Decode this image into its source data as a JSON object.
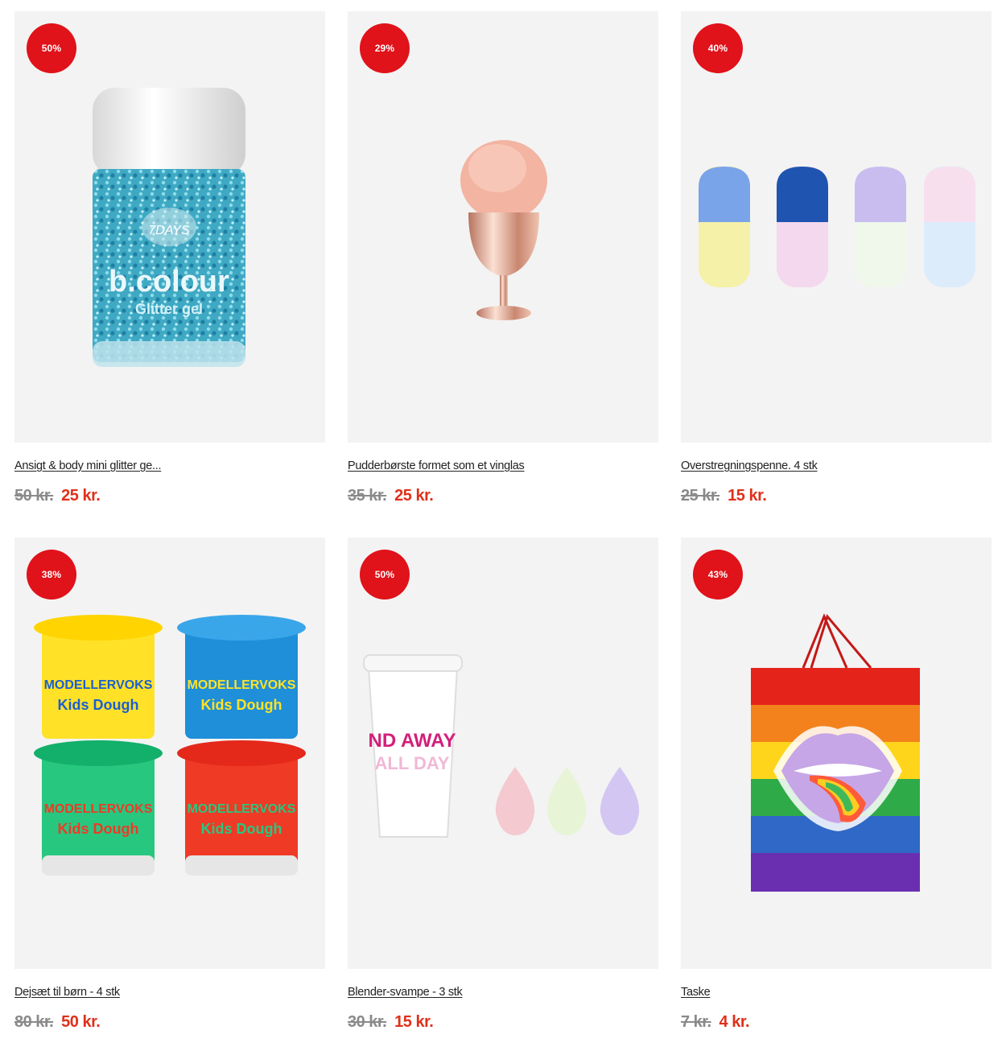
{
  "colors": {
    "badge": "#e0121a",
    "sale_price": "#e0301a",
    "old_price": "#8a8a8a",
    "card_background": "#f3f3f3"
  },
  "products": [
    {
      "discount": "50%",
      "title": "Ansigt & body mini glitter ge...",
      "old_price": "50 kr.",
      "new_price": "25 kr.",
      "image_text": {
        "brand": "7DAYS",
        "label": "b.colour",
        "sub": "Glitter gel"
      }
    },
    {
      "discount": "29%",
      "title": "Pudderbørste formet som et vinglas",
      "old_price": "35 kr.",
      "new_price": "25 kr."
    },
    {
      "discount": "40%",
      "title": "Overstregningspenne. 4 stk",
      "old_price": "25 kr.",
      "new_price": "15 kr."
    },
    {
      "discount": "38%",
      "title": "Dejsæt til børn - 4 stk",
      "old_price": "80 kr.",
      "new_price": "50 kr.",
      "image_text": {
        "line1": "MODELLERVOKS",
        "line2": "Kids Dough"
      }
    },
    {
      "discount": "50%",
      "title": "Blender-svampe - 3 stk",
      "old_price": "30 kr.",
      "new_price": "15 kr.",
      "image_text": {
        "line1": "ND AWAY",
        "line2": "ALL DAY"
      }
    },
    {
      "discount": "43%",
      "title": "Taske",
      "old_price": "7 kr.",
      "new_price": "4 kr."
    }
  ]
}
